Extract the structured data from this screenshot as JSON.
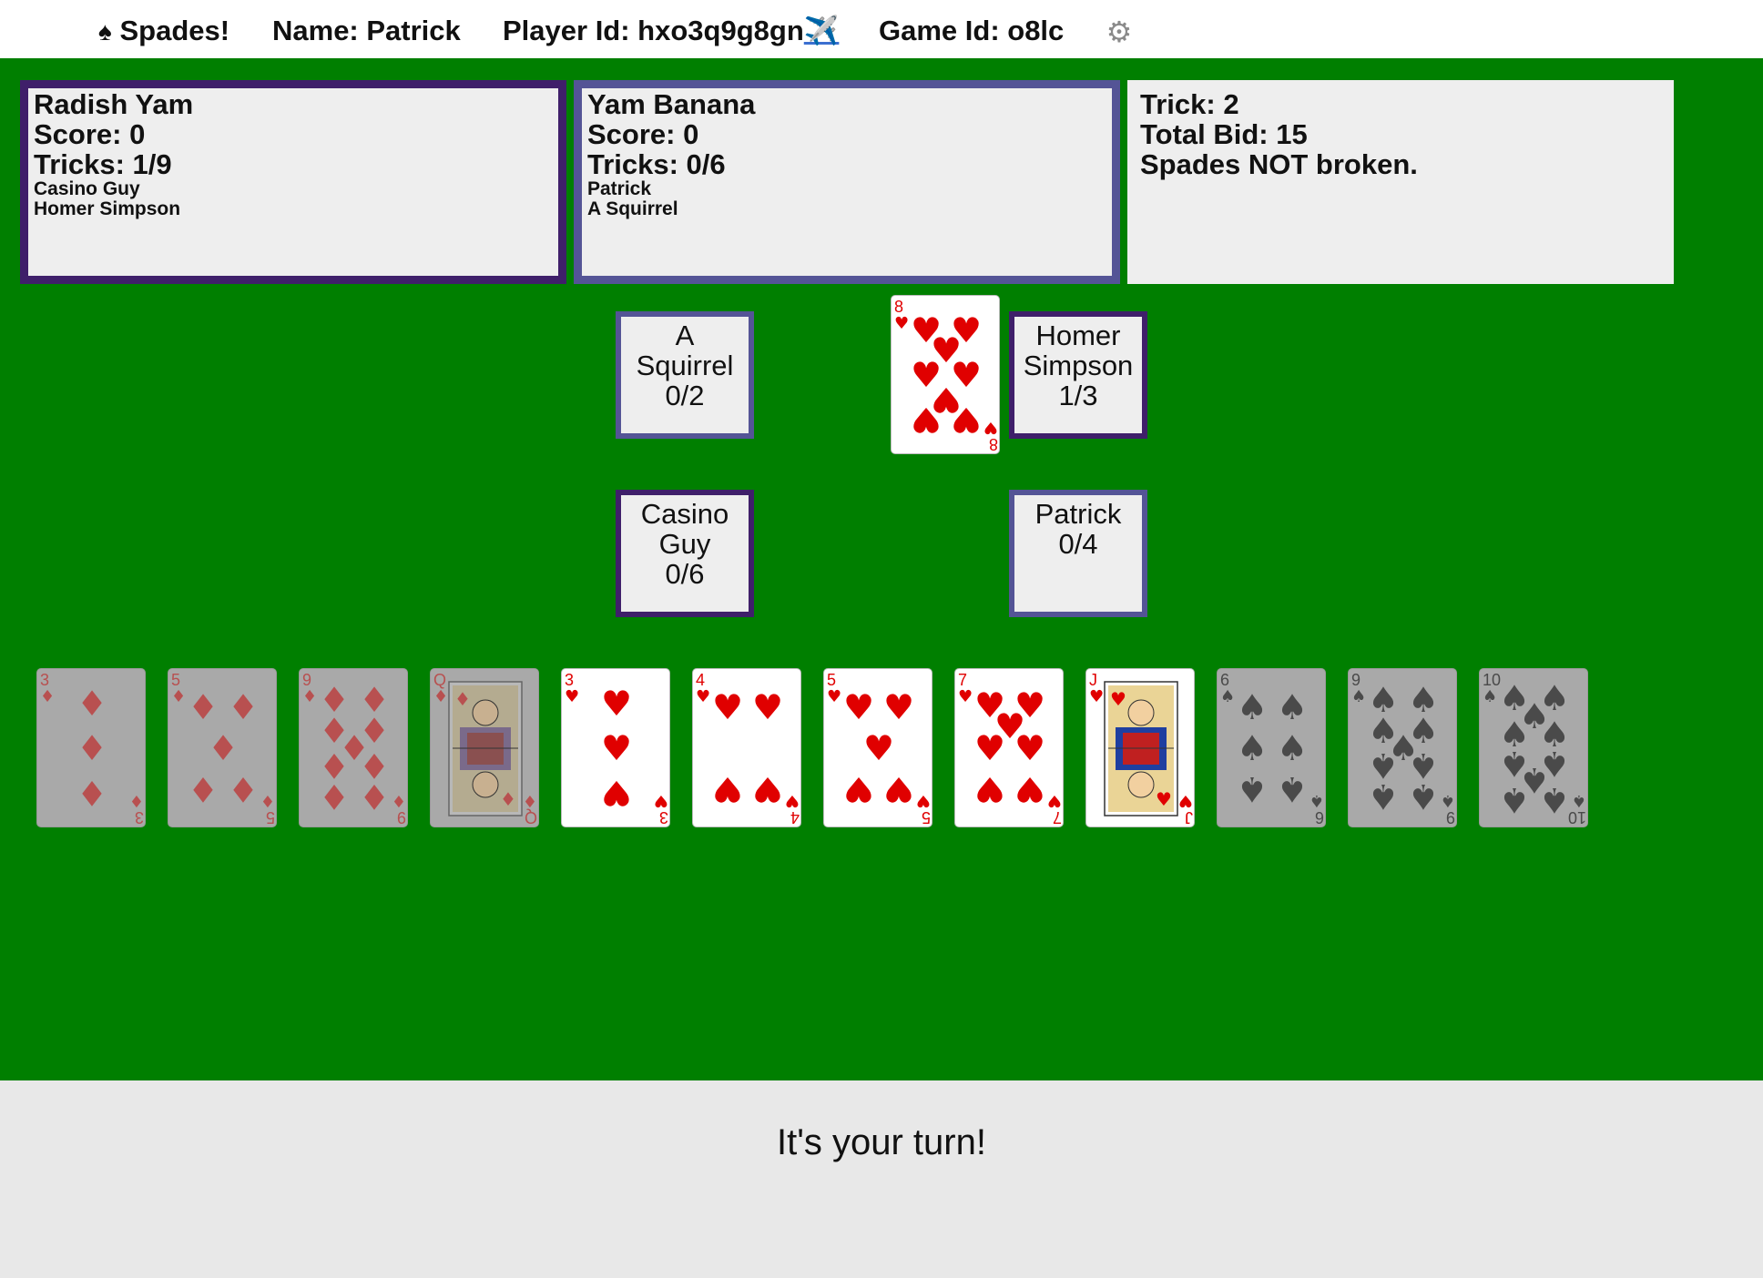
{
  "header": {
    "title": "Spades!",
    "spade_icon": "♠",
    "name": "Name: Patrick",
    "player_id": "Player Id: hxo3q9g8gn",
    "plane_icon": "✈️",
    "game_id": "Game Id: o8lc",
    "gear_icon": "⚙"
  },
  "teams": [
    {
      "name": "Radish Yam",
      "score": "Score: 0",
      "tricks": "Tricks: 1/9",
      "members": [
        "Casino Guy",
        "Homer Simpson"
      ],
      "color": "#3f1f6a"
    },
    {
      "name": "Yam Banana",
      "score": "Score: 0",
      "tricks": "Tricks: 0/6",
      "members": [
        "Patrick",
        "A Squirrel"
      ],
      "color": "#545496"
    }
  ],
  "info": {
    "trick": "Trick: 2",
    "total_bid": "Total Bid: 15",
    "spades_status": "Spades NOT broken."
  },
  "seats": {
    "top_left": {
      "name1": "A",
      "name2": "Squirrel",
      "tricks": "0/2"
    },
    "top_right": {
      "name1": "Homer",
      "name2": "Simpson",
      "tricks": "1/3"
    },
    "bottom_left": {
      "name1": "Casino",
      "name2": "Guy",
      "tricks": "0/6"
    },
    "bottom_right": {
      "name1": "Patrick",
      "tricks": "0/4"
    }
  },
  "played_card": {
    "rank": "8",
    "suit": "hearts"
  },
  "hand": [
    {
      "rank": "3",
      "suit": "diamonds",
      "playable": false
    },
    {
      "rank": "5",
      "suit": "diamonds",
      "playable": false
    },
    {
      "rank": "9",
      "suit": "diamonds",
      "playable": false
    },
    {
      "rank": "Q",
      "suit": "diamonds",
      "playable": false
    },
    {
      "rank": "3",
      "suit": "hearts",
      "playable": true
    },
    {
      "rank": "4",
      "suit": "hearts",
      "playable": true
    },
    {
      "rank": "5",
      "suit": "hearts",
      "playable": true
    },
    {
      "rank": "7",
      "suit": "hearts",
      "playable": true
    },
    {
      "rank": "J",
      "suit": "hearts",
      "playable": true
    },
    {
      "rank": "6",
      "suit": "spades",
      "playable": false
    },
    {
      "rank": "9",
      "suit": "spades",
      "playable": false
    },
    {
      "rank": "10",
      "suit": "spades",
      "playable": false
    }
  ],
  "status": "It's your turn!",
  "colors": {
    "felt": "#007f00",
    "team1_border": "#3f1f6a",
    "team2_border": "#545496",
    "panel_bg": "#eeeeee",
    "red_suit": "#e00000",
    "black_suit": "#111111"
  }
}
